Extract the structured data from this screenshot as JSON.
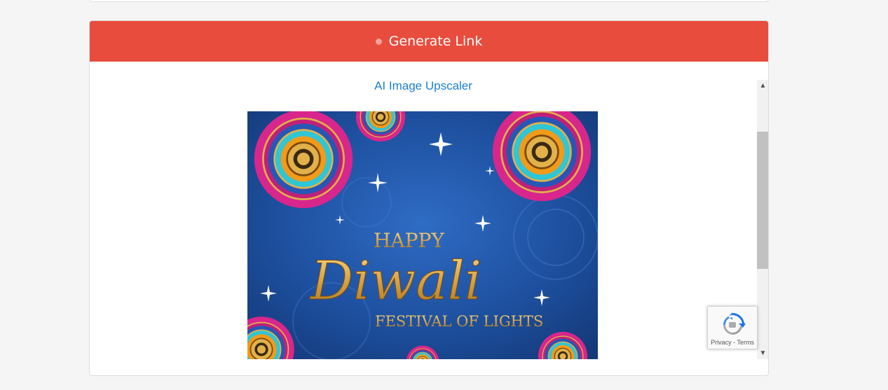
{
  "header": {
    "title": "Generate Link"
  },
  "main": {
    "link_text": "AI Image Upscaler",
    "image": {
      "line1": "HAPPY",
      "line2": "Diwali",
      "line3": "FESTIVAL OF LIGHTS"
    }
  },
  "scrollbar": {
    "up_arrow": "▲",
    "down_arrow": "▼"
  },
  "recaptcha": {
    "privacy": "Privacy",
    "separator": "-",
    "terms": "Terms"
  },
  "colors": {
    "header_bg": "#e84c3d",
    "link": "#1c7fd6",
    "image_bg": "#1a4a9a",
    "gold": "#e0b04a"
  },
  "icons": {
    "header_dot": "dot-icon",
    "recaptcha": "recaptcha-icon"
  }
}
